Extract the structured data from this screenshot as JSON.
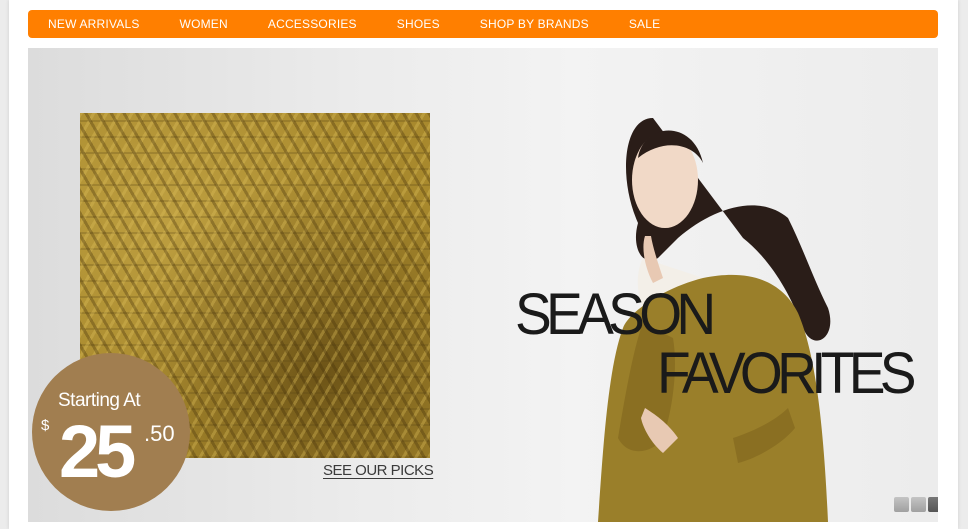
{
  "nav": {
    "items": [
      "NEW ARRIVALS",
      "WOMEN",
      "ACCESSORIES",
      "SHOES",
      "SHOP BY BRANDS",
      "SALE"
    ]
  },
  "hero": {
    "headline_line1": "SEASON",
    "headline_line2": "FAVORITES",
    "see_picks_label": "SEE OUR PICKS",
    "price_badge": {
      "label": "Starting At",
      "currency": "$",
      "amount": "25",
      "cents": ".50"
    },
    "slider": {
      "dot_count": 3,
      "active_index": 2
    }
  },
  "colors": {
    "nav_bg": "#ff7f00",
    "badge_bg": "#a17e50",
    "sweater": "#a8892d",
    "dot_inactive": "#a0a0a0",
    "dot_active": "#555555"
  }
}
